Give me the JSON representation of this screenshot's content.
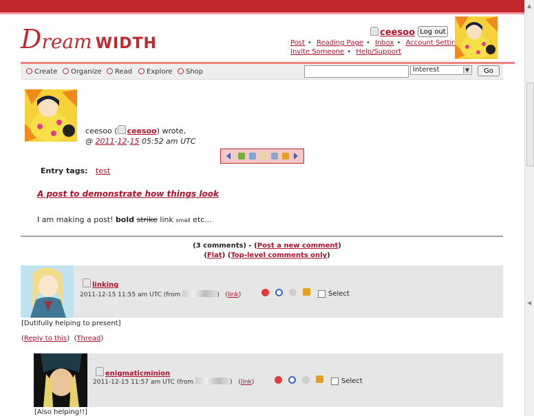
{
  "header": {
    "logo_d": "D",
    "logo_ream": "ream",
    "logo_width": "WIDTH",
    "username": "ceesoo",
    "logout_label": "Log out",
    "links": [
      "Post",
      "Reading Page",
      "Inbox",
      "Account Settings",
      "Invite Someone",
      "Help/Support"
    ]
  },
  "nav": {
    "items": [
      "Create",
      "Organize",
      "Read",
      "Explore",
      "Shop"
    ],
    "search_value": "",
    "select_value": "Interest",
    "go_label": "Go"
  },
  "post": {
    "poster_name": "ceesoo",
    "poster_user": "ceesoo",
    "wrote": "wrote,",
    "date_prefix": "@",
    "year": "2011",
    "month": "12",
    "day": "15",
    "time": "05:52 am UTC",
    "tags_label": "Entry tags:",
    "tag": "test",
    "subject": "A post to demonstrate how things look",
    "body_start": "I am making a post!",
    "body_bold": "bold",
    "body_strike": "strike",
    "body_link": "link",
    "body_small": "small",
    "body_end": "etc..."
  },
  "comments_summary": {
    "count_text": "(3 comments)",
    "post_new": "Post a new comment",
    "flat": "Flat",
    "top_level": "Top-level comments only"
  },
  "comments": [
    {
      "user": "linking",
      "timestamp": "2011-12-15 11:55 am UTC",
      "from_label": "(from",
      "link_label": "link",
      "select_label": "Select",
      "text": "[Dutifully helping to present]",
      "reply_label": "Reply to this",
      "thread_label": "Thread"
    },
    {
      "user": "enigmaticminion",
      "timestamp": "2011-12-15 11:57 am UTC",
      "from_label": "(from",
      "link_label": "link",
      "select_label": "Select",
      "text": "[Also helping!!]"
    }
  ],
  "colors": {
    "accent": "#c1272d",
    "link": "#b0102b",
    "comment_bg": "#e6e6e6"
  }
}
